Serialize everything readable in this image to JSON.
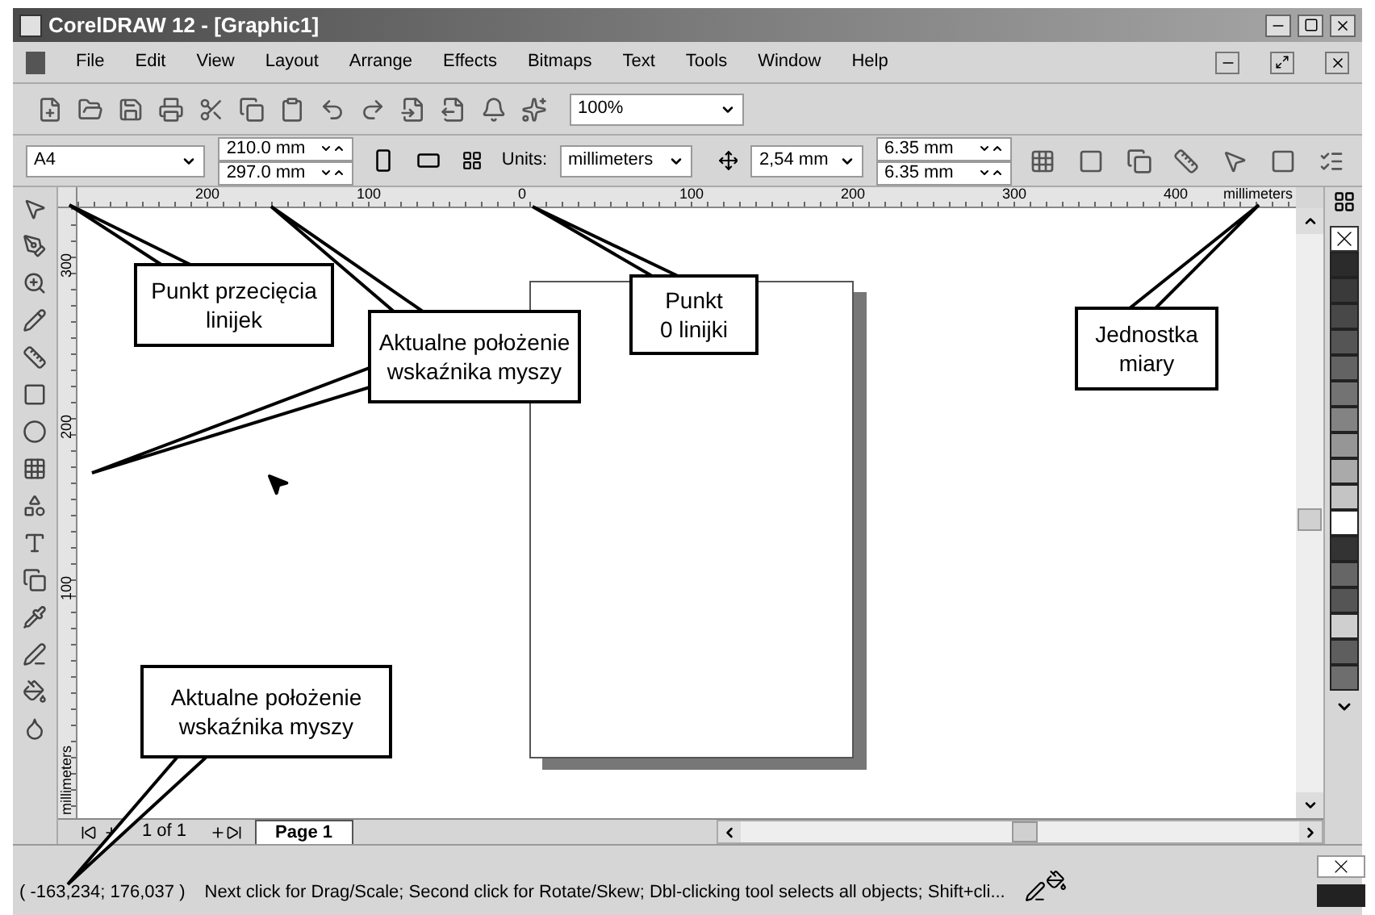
{
  "window": {
    "title": "CorelDRAW 12 - [Graphic1]"
  },
  "menu": [
    {
      "label": "File"
    },
    {
      "label": "Edit"
    },
    {
      "label": "View"
    },
    {
      "label": "Layout"
    },
    {
      "label": "Arrange"
    },
    {
      "label": "Effects"
    },
    {
      "label": "Bitmaps"
    },
    {
      "label": "Text"
    },
    {
      "label": "Tools"
    },
    {
      "label": "Window"
    },
    {
      "label": "Help"
    }
  ],
  "toolbar": {
    "zoom": "100%"
  },
  "property_bar": {
    "paper": "A4",
    "width": "210.0 mm",
    "height": "297.0 mm",
    "units_label": "Units:",
    "units": "millimeters",
    "nudge": "2,54 mm",
    "dup_x": "6.35 mm",
    "dup_y": "6.35 mm"
  },
  "ruler": {
    "h_labels": [
      "200",
      "100",
      "0",
      "100",
      "200",
      "300",
      "400"
    ],
    "h_units": "millimeters",
    "v_labels": [
      "300",
      "200",
      "100"
    ],
    "v_units": "millimeters"
  },
  "page_tabs": {
    "counter": "1 of 1",
    "tab": "Page 1"
  },
  "palette": [
    {
      "color": "#2b2b2b"
    },
    {
      "color": "#3a3a3a"
    },
    {
      "color": "#484848"
    },
    {
      "color": "#555555"
    },
    {
      "color": "#636363"
    },
    {
      "color": "#737373"
    },
    {
      "color": "#838383"
    },
    {
      "color": "#969696"
    },
    {
      "color": "#aaaaaa"
    },
    {
      "color": "#c4c4c4"
    },
    {
      "color": "#ffffff"
    },
    {
      "color": "#333333"
    },
    {
      "color": "#666666"
    },
    {
      "color": "#555555"
    },
    {
      "color": "#cfcfcf"
    },
    {
      "color": "#5e5e5e"
    },
    {
      "color": "#6e6e6e"
    }
  ],
  "status_bar": {
    "coords": "( -163,234; 176,037 )",
    "hint": "Next click for Drag/Scale; Second click for Rotate/Skew; Dbl-clicking tool selects all objects; Shift+cli..."
  },
  "callouts": [
    {
      "text": "Punkt przecięcia\nlinijek"
    },
    {
      "text": "Aktualne położenie\nwskaźnika myszy"
    },
    {
      "text": "Punkt\n0 linijki"
    },
    {
      "text": "Jednostka\nmiary"
    },
    {
      "text": "Aktualne położenie\nwskaźnika myszy"
    }
  ]
}
